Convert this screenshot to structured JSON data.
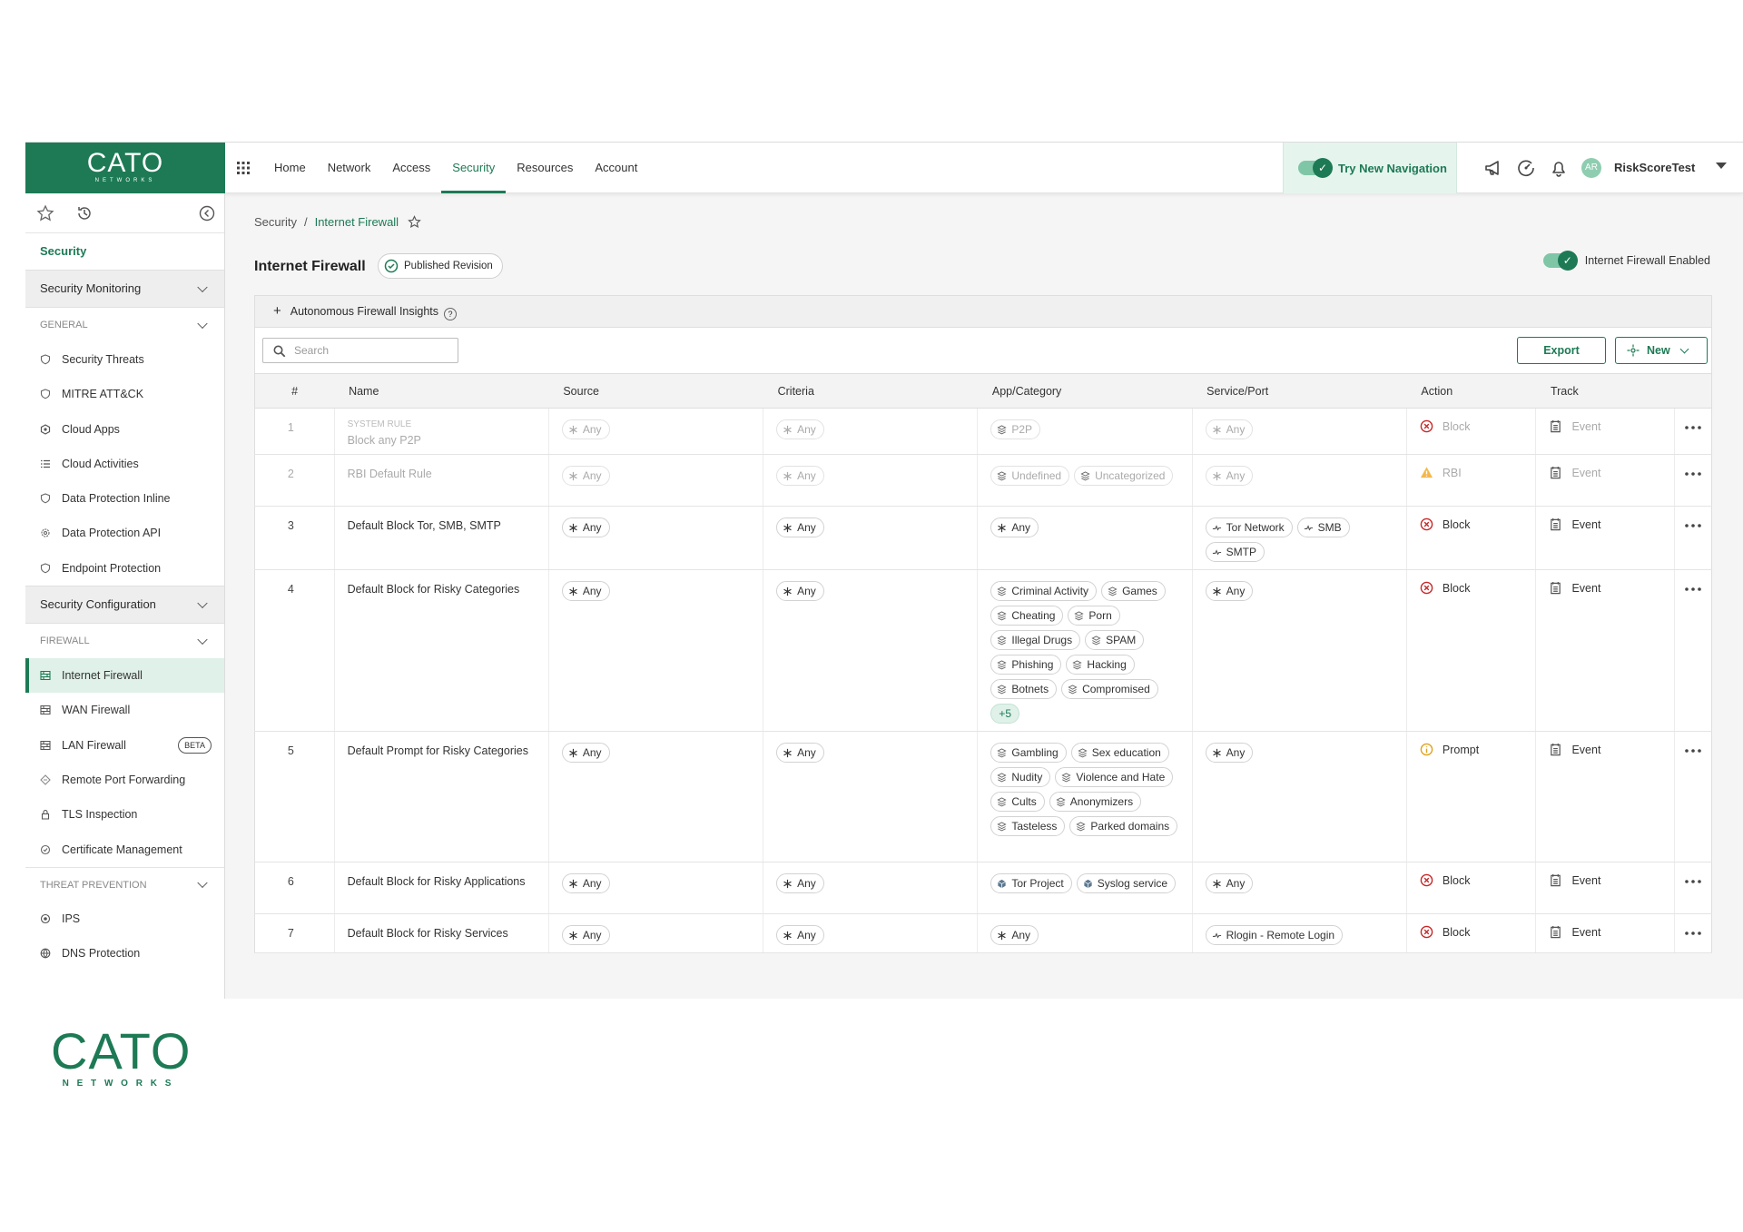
{
  "app": {
    "logo_text": "CATO",
    "logo_sub": "NETWORKS",
    "nav": [
      {
        "label": "Home"
      },
      {
        "label": "Network"
      },
      {
        "label": "Access"
      },
      {
        "label": "Security",
        "active": true
      },
      {
        "label": "Resources"
      },
      {
        "label": "Account"
      }
    ],
    "try_new_nav": "Try New Navigation",
    "avatar_initials": "AR",
    "user_name": "RiskScoreTest",
    "accent_color": "#1d7a55"
  },
  "sidebar": {
    "title": "Security",
    "group_monitoring": "Security Monitoring",
    "section_general": "GENERAL",
    "general_items": [
      "Security Threats",
      "MITRE ATT&CK",
      "Cloud Apps",
      "Cloud Activities",
      "Data Protection Inline",
      "Data Protection API",
      "Endpoint Protection"
    ],
    "group_config": "Security Configuration",
    "section_firewall": "FIREWALL",
    "firewall_items": [
      "Internet Firewall",
      "WAN Firewall",
      "LAN Firewall",
      "Remote Port Forwarding",
      "TLS Inspection",
      "Certificate Management"
    ],
    "beta_label": "BETA",
    "section_threat": "THREAT PREVENTION",
    "threat_items": [
      "IPS",
      "DNS Protection"
    ]
  },
  "page": {
    "breadcrumb_root": "Security",
    "breadcrumb_sep": "/",
    "breadcrumb_current": "Internet Firewall",
    "title": "Internet Firewall",
    "revision_badge": "Published Revision",
    "enabled_label": "Internet Firewall Enabled",
    "insights_label": "Autonomous Firewall Insights",
    "insights_plus": "+",
    "insights_help": "?",
    "search_placeholder": "Search",
    "export_label": "Export",
    "new_label": "New"
  },
  "table": {
    "columns": [
      "#",
      "Name",
      "Source",
      "Criteria",
      "App/Category",
      "Service/Port",
      "Action",
      "Track"
    ],
    "rows": [
      {
        "num": "1",
        "system": "SYSTEM RULE",
        "name": "Block any P2P",
        "source": [
          "Any"
        ],
        "criteria": [
          "Any"
        ],
        "app": [
          "P2P"
        ],
        "service": [
          "Any"
        ],
        "action": "Block",
        "track": "Event",
        "dim": true
      },
      {
        "num": "2",
        "name": "RBI Default Rule",
        "source": [
          "Any"
        ],
        "criteria": [
          "Any"
        ],
        "app": [
          "Undefined",
          "Uncategorized"
        ],
        "service": [
          "Any"
        ],
        "action": "RBI",
        "track": "Event",
        "dim": true
      },
      {
        "num": "3",
        "name": "Default Block Tor, SMB, SMTP",
        "source": [
          "Any"
        ],
        "criteria": [
          "Any"
        ],
        "app": [
          "Any"
        ],
        "service": [
          "Tor Network",
          "SMB",
          "SMTP"
        ],
        "action": "Block",
        "track": "Event"
      },
      {
        "num": "4",
        "name": "Default Block for Risky Categories",
        "source": [
          "Any"
        ],
        "criteria": [
          "Any"
        ],
        "app": [
          "Criminal Activity",
          "Games",
          "Cheating",
          "Porn",
          "Illegal Drugs",
          "SPAM",
          "Phishing",
          "Hacking",
          "Botnets",
          "Compromised"
        ],
        "app_more": "+5",
        "service": [
          "Any"
        ],
        "action": "Block",
        "track": "Event"
      },
      {
        "num": "5",
        "name": "Default Prompt for Risky Categories",
        "source": [
          "Any"
        ],
        "criteria": [
          "Any"
        ],
        "app": [
          "Gambling",
          "Sex education",
          "Nudity",
          "Violence and Hate",
          "Cults",
          "Anonymizers",
          "Tasteless",
          "Parked domains"
        ],
        "service": [
          "Any"
        ],
        "action": "Prompt",
        "track": "Event"
      },
      {
        "num": "6",
        "name": "Default Block for Risky Applications",
        "source": [
          "Any"
        ],
        "criteria": [
          "Any"
        ],
        "app": [
          "Tor Project",
          "Syslog service"
        ],
        "service": [
          "Any"
        ],
        "action": "Block",
        "track": "Event"
      },
      {
        "num": "7",
        "name": "Default Block for Risky Services",
        "source": [
          "Any"
        ],
        "criteria": [
          "Any"
        ],
        "app": [
          "Any"
        ],
        "service": [
          "Rlogin - Remote Login"
        ],
        "action": "Block",
        "track": "Event"
      }
    ]
  },
  "footer_logo": {
    "text": "CATO",
    "sub": "N E T W O R K S"
  }
}
